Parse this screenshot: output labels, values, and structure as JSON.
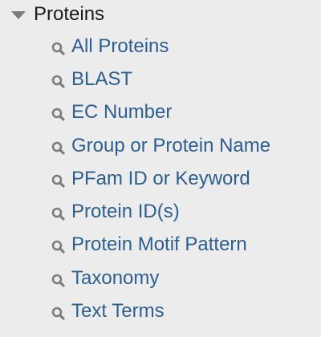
{
  "section": {
    "title": "Proteins",
    "items": [
      {
        "label": "All Proteins",
        "icon": "search-icon"
      },
      {
        "label": "BLAST",
        "icon": "search-icon"
      },
      {
        "label": "EC Number",
        "icon": "search-icon"
      },
      {
        "label": "Group or Protein Name",
        "icon": "search-icon"
      },
      {
        "label": "PFam ID or Keyword",
        "icon": "search-icon"
      },
      {
        "label": "Protein ID(s)",
        "icon": "search-icon"
      },
      {
        "label": "Protein Motif Pattern",
        "icon": "search-icon"
      },
      {
        "label": "Taxonomy",
        "icon": "search-icon"
      },
      {
        "label": "Text Terms",
        "icon": "search-icon"
      }
    ]
  },
  "colors": {
    "background": "#ececec",
    "link": "#2c5f8f",
    "header_text": "#1a1a1a",
    "icon": "#7d7d7d"
  }
}
